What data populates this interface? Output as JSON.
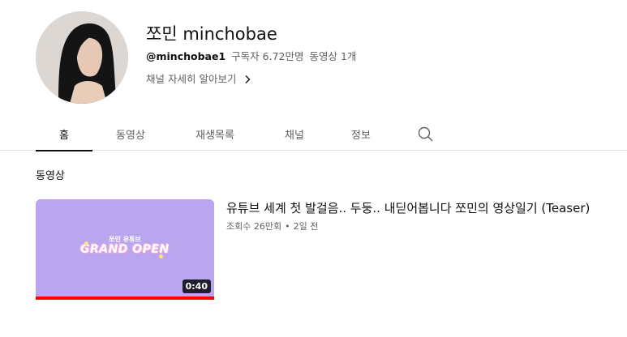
{
  "channel": {
    "name": "쪼민 minchobae",
    "handle": "@minchobae1",
    "subscribers": "구독자 6.72만명",
    "video_count": "동영상 1개",
    "more_link": "채널 자세히 알아보기"
  },
  "tabs": [
    {
      "label": "홈"
    },
    {
      "label": "동영상"
    },
    {
      "label": "재생목록"
    },
    {
      "label": "채널"
    },
    {
      "label": "정보"
    }
  ],
  "section": {
    "title": "동영상"
  },
  "video": {
    "title": "유튜브 세계 첫 발걸음.. 두둥.. 내딛어봅니다 쪼민의 영상일기 (Teaser)",
    "views": "조회수 26만회",
    "age": "2일 전",
    "duration": "0:40",
    "progress_fraction": 1.0,
    "thumbnail_line1": "쪼민 유튜브",
    "thumbnail_line2": "GRAND OPEN"
  },
  "colors": {
    "thumbnail_bg": "#b9a6ee",
    "progress_red": "#ff0000",
    "text_secondary": "#606060"
  }
}
